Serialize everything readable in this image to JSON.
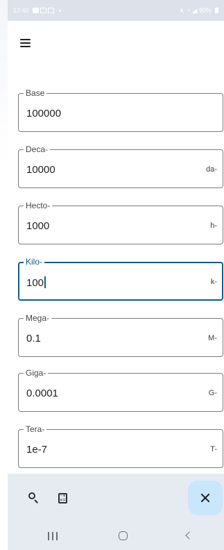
{
  "status_bar": {
    "time": "12:40",
    "battery": "90%",
    "icons": [
      "notification-icon",
      "message-icon",
      "message-icon",
      "mute-icon",
      "wifi-icon",
      "signal-icon",
      "battery-icon"
    ]
  },
  "toolbar": {
    "menu_icon": "hamburger-menu-icon"
  },
  "fields": [
    {
      "label": "Base",
      "value": "100000",
      "suffix": ""
    },
    {
      "label": "Deca-",
      "value": "10000",
      "suffix": "da-"
    },
    {
      "label": "Hecto-",
      "value": "1000",
      "suffix": "h-"
    },
    {
      "label": "Kilo-",
      "value": "100",
      "suffix": "k-",
      "focused": true
    },
    {
      "label": "Mega-",
      "value": "0.1",
      "suffix": "M-"
    },
    {
      "label": "Giga-",
      "value": "0.0001",
      "suffix": "G-"
    },
    {
      "label": "Tera-",
      "value": "1e-7",
      "suffix": "T-"
    }
  ],
  "bottom_bar": {
    "search_icon": "search-icon",
    "calculator_icon": "calculator-icon",
    "fab_icon": "close-icon"
  },
  "colors": {
    "accent": "#0d5d8a",
    "fab_background": "#c9e6fb",
    "bar_background": "#e6ebf1",
    "outline": "#777b80"
  },
  "nav_bar": {
    "buttons": [
      "recents-icon",
      "home-icon",
      "back-icon"
    ]
  }
}
